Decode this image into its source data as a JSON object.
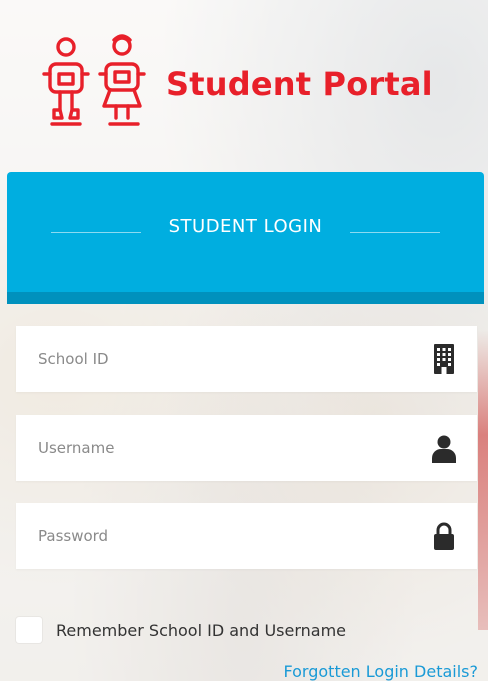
{
  "brand": {
    "title": "Student Portal",
    "color": "#e8202a"
  },
  "login_header": {
    "title": "STUDENT LOGIN",
    "color": "#00aee0",
    "bottom_color": "#0091bd"
  },
  "fields": [
    {
      "name": "school-id",
      "placeholder": "School ID",
      "value": "",
      "icon": "building-icon"
    },
    {
      "name": "username",
      "placeholder": "Username",
      "value": "",
      "icon": "user-icon"
    },
    {
      "name": "password",
      "placeholder": "Password",
      "value": "",
      "icon": "lock-icon"
    }
  ],
  "remember": {
    "label": "Remember School ID and Username",
    "checked": false
  },
  "forgot_link": {
    "label": "Forgotten Login Details?",
    "color": "#1a9ad6"
  },
  "icon_color": "#2b2b2b"
}
